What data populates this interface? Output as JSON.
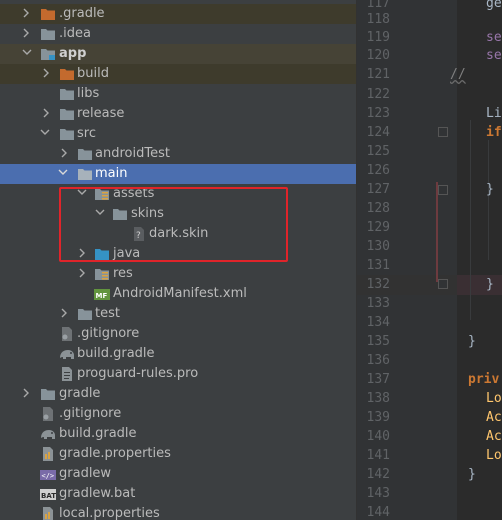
{
  "tree": {
    "rows": [
      {
        "label": ".gradle"
      },
      {
        "label": ".idea"
      },
      {
        "label": "app"
      },
      {
        "label": "build"
      },
      {
        "label": "libs"
      },
      {
        "label": "release"
      },
      {
        "label": "src"
      },
      {
        "label": "androidTest"
      },
      {
        "label": "main"
      },
      {
        "label": "assets"
      },
      {
        "label": "skins"
      },
      {
        "label": "dark.skin"
      },
      {
        "label": "java"
      },
      {
        "label": "res"
      },
      {
        "label": "AndroidManifest.xml"
      },
      {
        "label": "test"
      },
      {
        "label": ".gitignore"
      },
      {
        "label": "build.gradle"
      },
      {
        "label": "proguard-rules.pro"
      },
      {
        "label": "gradle"
      },
      {
        "label": ".gitignore"
      },
      {
        "label": "build.gradle"
      },
      {
        "label": "gradle.properties"
      },
      {
        "label": "gradlew"
      },
      {
        "label": "gradlew.bat"
      },
      {
        "label": "local.properties"
      }
    ]
  },
  "editor": {
    "line_numbers": [
      "117",
      "118",
      "119",
      "120",
      "121",
      "122",
      "123",
      "124",
      "125",
      "126",
      "127",
      "128",
      "129",
      "130",
      "131",
      "132",
      "133",
      "134",
      "135",
      "136",
      "137",
      "138",
      "139",
      "140",
      "141",
      "142",
      "143",
      "144"
    ],
    "code": {
      "l117": "ge",
      "l119": "se",
      "l120": "se",
      "l121": "//",
      "l123": "Li",
      "l124": "if",
      "l127": "}",
      "l132": "}",
      "l135": "}",
      "l137": "priv",
      "l138": "Lo",
      "l139": "Ac",
      "l140": "Ac",
      "l141": "Lo",
      "l142": "}"
    }
  },
  "colors": {
    "selection": "#4b6eaf",
    "folder": "#87939a",
    "excluded_folder": "#c36a2e",
    "source_folder": "#3592c4",
    "annotation_box": "#e0242a"
  }
}
